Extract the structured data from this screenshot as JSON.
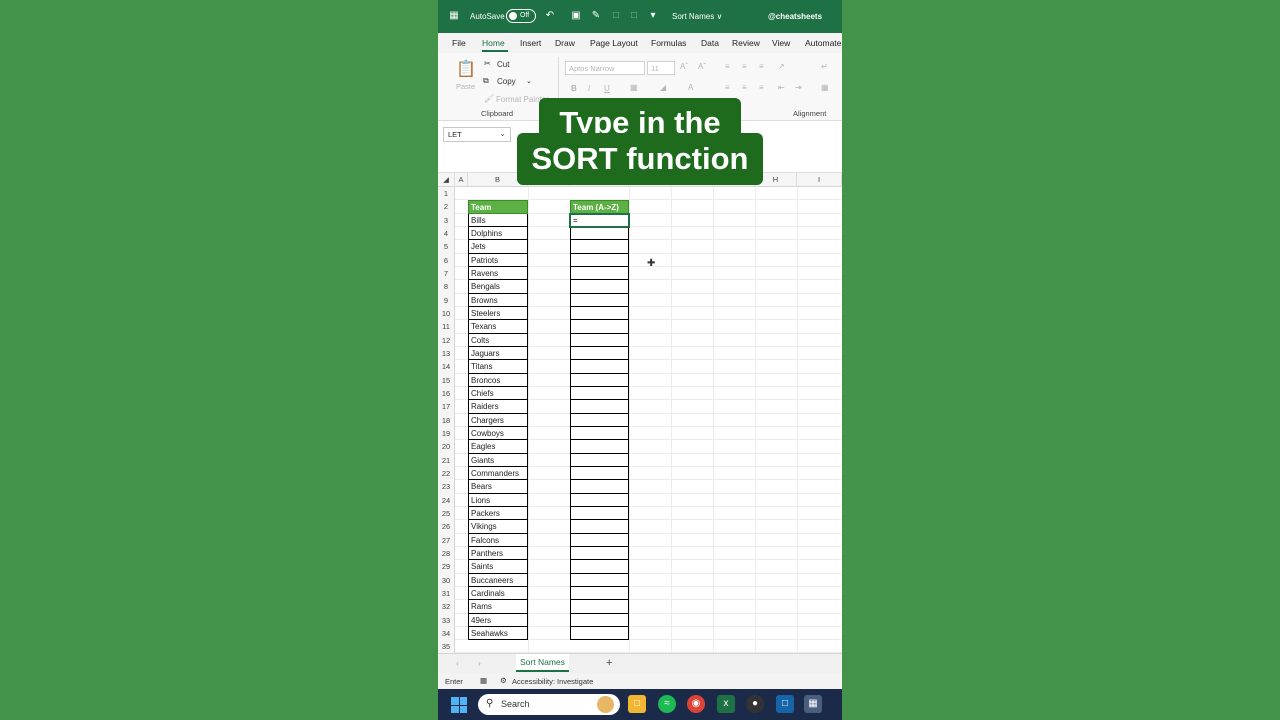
{
  "titlebar": {
    "autosave_label": "AutoSave",
    "autosave_state": "Off",
    "document_title": "Sort Names ∨",
    "handle": "@cheatsheets"
  },
  "menu": {
    "tabs": [
      "File",
      "Home",
      "Insert",
      "Draw",
      "Page Layout",
      "Formulas",
      "Data",
      "Review",
      "View",
      "Automate"
    ],
    "active": "Home"
  },
  "ribbon": {
    "paste": "Paste",
    "cut": "Cut",
    "copy": "Copy",
    "format_painter": "Format Painter",
    "font_name": "Aptos Narrow",
    "font_size": "11",
    "clipboard_group": "Clipboard",
    "alignment_group": "Alignment"
  },
  "formula_bar": {
    "name_box": "LET"
  },
  "grid": {
    "columns": [
      "A",
      "B",
      "H",
      "I"
    ],
    "row_numbers": [
      "1",
      "2",
      "3",
      "4",
      "5",
      "6",
      "7",
      "8",
      "9",
      "10",
      "11",
      "12",
      "13",
      "14",
      "15",
      "16",
      "17",
      "18",
      "19",
      "20",
      "21",
      "22",
      "23",
      "24",
      "25",
      "26",
      "27",
      "28",
      "29",
      "30",
      "31",
      "32",
      "33",
      "34",
      "35"
    ],
    "header_b": "Team",
    "header_d": "Team (A->Z)",
    "teams": [
      "Bills",
      "Dolphins",
      "Jets",
      "Patriots",
      "Ravens",
      "Bengals",
      "Browns",
      "Steelers",
      "Texans",
      "Colts",
      "Jaguars",
      "Titans",
      "Broncos",
      "Chiefs",
      "Raiders",
      "Chargers",
      "Cowboys",
      "Eagles",
      "Giants",
      "Commanders",
      "Bears",
      "Lions",
      "Packers",
      "Vikings",
      "Falcons",
      "Panthers",
      "Saints",
      "Buccaneers",
      "Cardinals",
      "Rams",
      "49ers",
      "Seahawks"
    ],
    "active_cell_value": "="
  },
  "sheet": {
    "tab_name": "Sort Names",
    "add_sheet": "+"
  },
  "status": {
    "mode": "Enter",
    "accessibility": "Accessibility: Investigate"
  },
  "taskbar": {
    "search_placeholder": "Search"
  },
  "caption": {
    "line1": "Type in the",
    "line2": "SORT function"
  },
  "colors": {
    "excel_green": "#1e7145",
    "header_fill": "#5cb144",
    "background": "#44934b",
    "caption_bg": "#1e6b1e"
  }
}
